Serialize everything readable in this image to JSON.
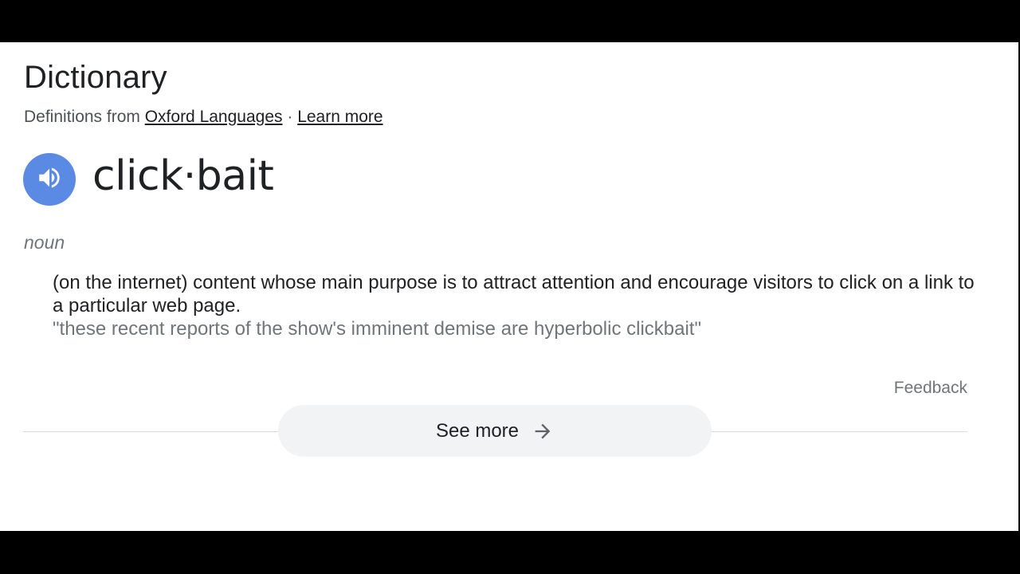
{
  "dictionary": {
    "heading": "Dictionary",
    "source": {
      "prefix": "Definitions from ",
      "provider_link": "Oxford Languages",
      "separator": " · ",
      "learn_more_link": "Learn more"
    },
    "entry": {
      "word": "click·bait",
      "pronounce_icon": "speaker-icon",
      "part_of_speech": "noun",
      "definition": "(on the internet) content whose main purpose is to attract attention and encourage visitors to click on a link to a particular web page.",
      "example": "\"these recent reports of the show's imminent demise are hyperbolic clickbait\""
    },
    "feedback_label": "Feedback",
    "see_more": {
      "label": "See more",
      "icon": "arrow-right-icon"
    }
  },
  "colors": {
    "speaker_button": "#5b8ae4",
    "see_more_bg": "#f1f3f4",
    "secondary_text": "#70757a",
    "primary_text": "#202124"
  }
}
